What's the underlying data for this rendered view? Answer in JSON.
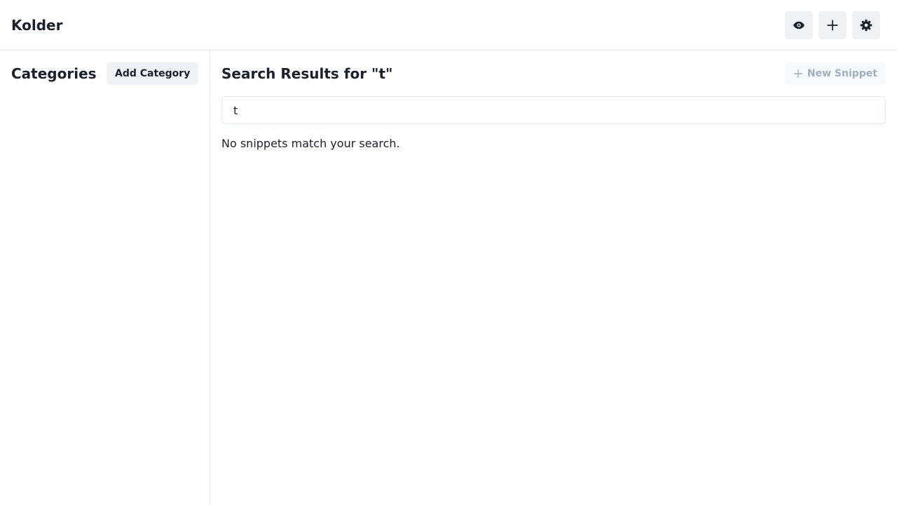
{
  "header": {
    "title": "Kolder",
    "actions": [
      {
        "icon": "eye-icon"
      },
      {
        "icon": "plus-icon"
      },
      {
        "icon": "gear-icon"
      }
    ]
  },
  "sidebar": {
    "heading": "Categories",
    "add_category_label": "Add Category"
  },
  "main": {
    "results_title": "Search Results for \"t\"",
    "new_snippet_label": "New Snippet",
    "new_snippet_icon": "plus-icon",
    "new_snippet_disabled": true,
    "search": {
      "value": "t"
    },
    "empty_message": "No snippets match your search."
  },
  "colors": {
    "text": "#1a202c",
    "button_bg": "#edf2f7",
    "disabled_text": "#a0aec0",
    "border": "#e2e8f0"
  }
}
